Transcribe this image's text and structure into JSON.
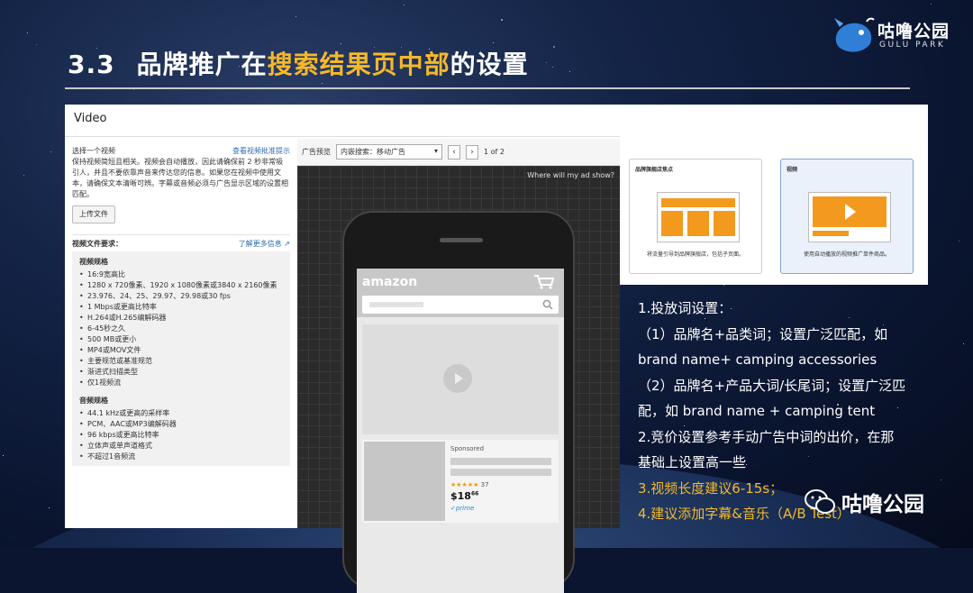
{
  "slide": {
    "number": "3.3",
    "title_pre": "品牌推广在",
    "title_highlight": "搜索结果页中部",
    "title_post": "的设置"
  },
  "logo": {
    "name": "咕噜公园",
    "sub": "GULU PARK"
  },
  "video_panel": {
    "header": "Video",
    "choose_label": "选择一个视频",
    "view_guidelines": "查看视频批准提示",
    "description": "保持视频简短且相关。视频会自动播放，因此请确保前 2 秒非常吸引人，并且不要依靠声音来传达您的信息。如果您在视频中使用文本，请确保文本清晰可辨。字幕或音频必须与广告显示区域的设置相匹配。",
    "upload_button": "上传文件",
    "file_req_title": "视频文件要求：",
    "learn_more": "了解更多信息",
    "video_spec_title": "视频规格",
    "video_specs": [
      "16:9宽高比",
      "1280 x 720像素、1920 x 1080像素或3840 x 2160像素",
      "23.976、24、25、29.97、29.98或30 fps",
      "1 Mbps或更高比特率",
      "H.264或H.265编解码器",
      "6-45秒之久",
      "500 MB或更小",
      "MP4或MOV文件",
      "主要规范或基准规范",
      "渐进式扫描类型",
      "仅1视频流"
    ],
    "audio_spec_title": "音频规格",
    "audio_specs": [
      "44.1 kHz或更高的采样率",
      "PCM、AAC或MP3编解码器",
      "96 kbps或更高比特率",
      "立体声或单声道格式",
      "不超过1音频流"
    ],
    "preview_label": "广告预览",
    "preview_select": "内嵌搜索：移动广告",
    "page_info": "1 of 2",
    "where_show": "Where will my ad show?",
    "amazon_logo": "amazon",
    "sponsored": "Sponsored",
    "rating_count": "37",
    "price": "$18",
    "price_cents": "66",
    "prime": "✓prime"
  },
  "format_tiles": [
    {
      "title": "品牌旗舰店焦点",
      "desc": "将流量引导到品牌旗舰店，包括子页面。"
    },
    {
      "title": "视频",
      "desc": "使用自动播放的视频推广单件商品。"
    }
  ],
  "notes": [
    {
      "text": "1.投放词设置：",
      "color": "white"
    },
    {
      "text": "（1）品牌名+品类词；设置广泛匹配，如",
      "color": "white"
    },
    {
      "text": "brand name+ camping accessories",
      "color": "white"
    },
    {
      "text": "（2）品牌名+产品大词/长尾词；设置广泛匹",
      "color": "white"
    },
    {
      "text": "配，如 brand name + camping tent",
      "color": "white"
    },
    {
      "text": "2.竞价设置参考手动广告中词的出价，在那",
      "color": "white"
    },
    {
      "text": "基础上设置高一些",
      "color": "white"
    },
    {
      "text": "3.视频长度建议6-15s；",
      "color": "yellow"
    },
    {
      "text": "4.建议添加字幕&音乐（A/B Test）",
      "color": "yellow"
    }
  ],
  "wechat": {
    "name": "咕噜公园"
  }
}
